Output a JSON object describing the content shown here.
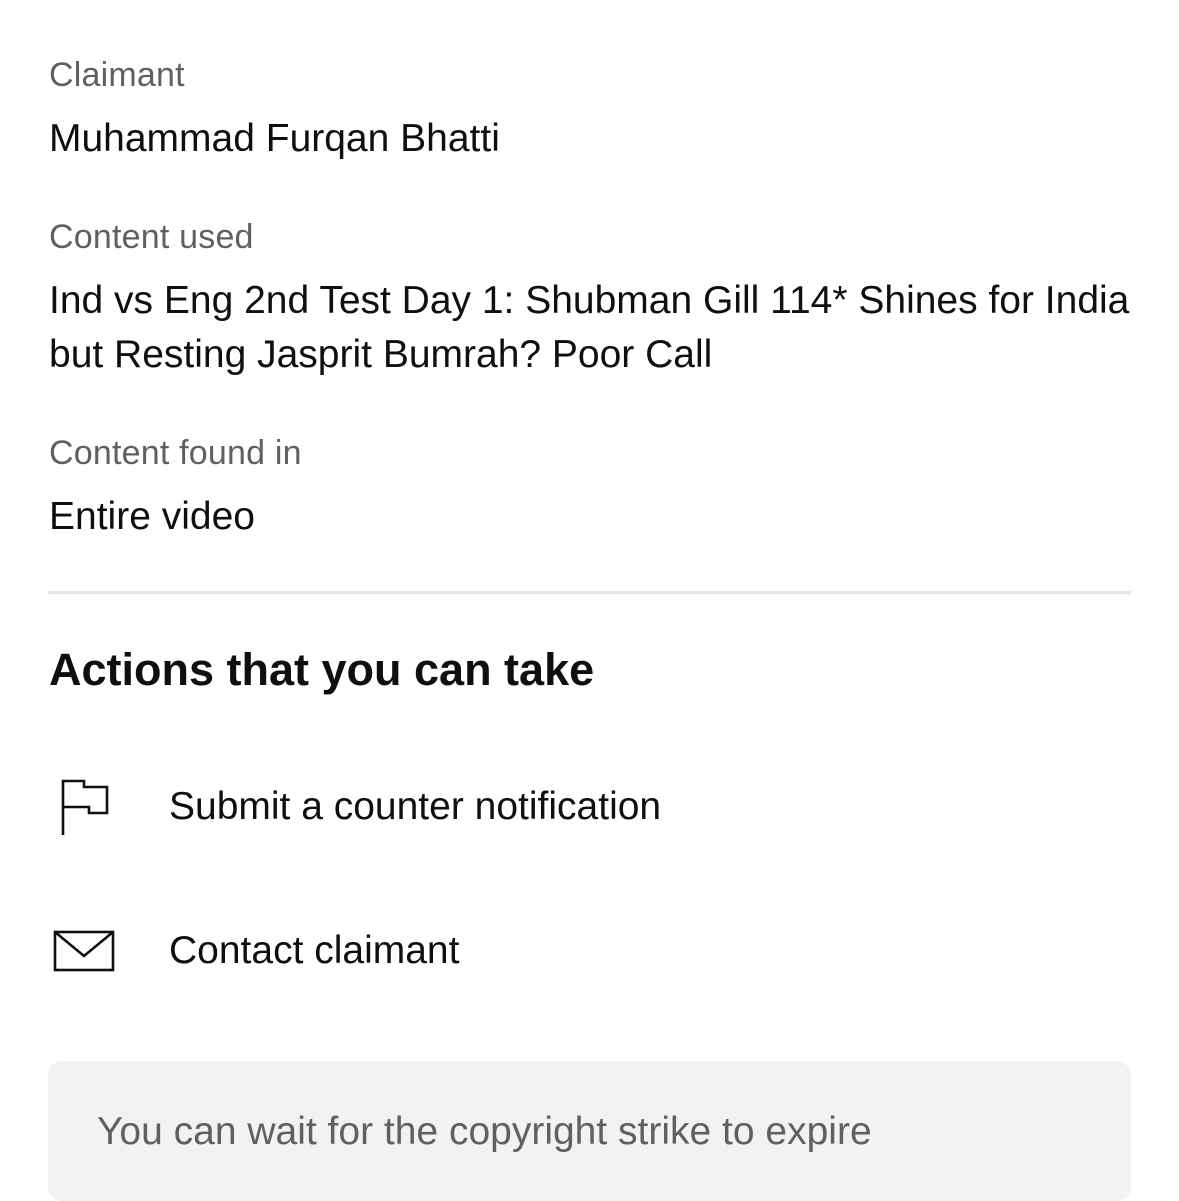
{
  "details": {
    "claimant_label": "Claimant",
    "claimant_value": "Muhammad Furqan Bhatti",
    "content_used_label": "Content used",
    "content_used_value": "Ind vs Eng 2nd Test Day 1: Shubman Gill 114* Shines for India but Resting Jasprit Bumrah? Poor Call",
    "content_found_label": "Content found in",
    "content_found_value": "Entire video"
  },
  "actions": {
    "heading": "Actions that you can take",
    "items": [
      {
        "label": "Submit a counter notification",
        "icon": "flag-icon"
      },
      {
        "label": "Contact claimant",
        "icon": "mail-icon"
      }
    ]
  },
  "info_box": {
    "text": "You can wait for the copyright strike to expire"
  }
}
